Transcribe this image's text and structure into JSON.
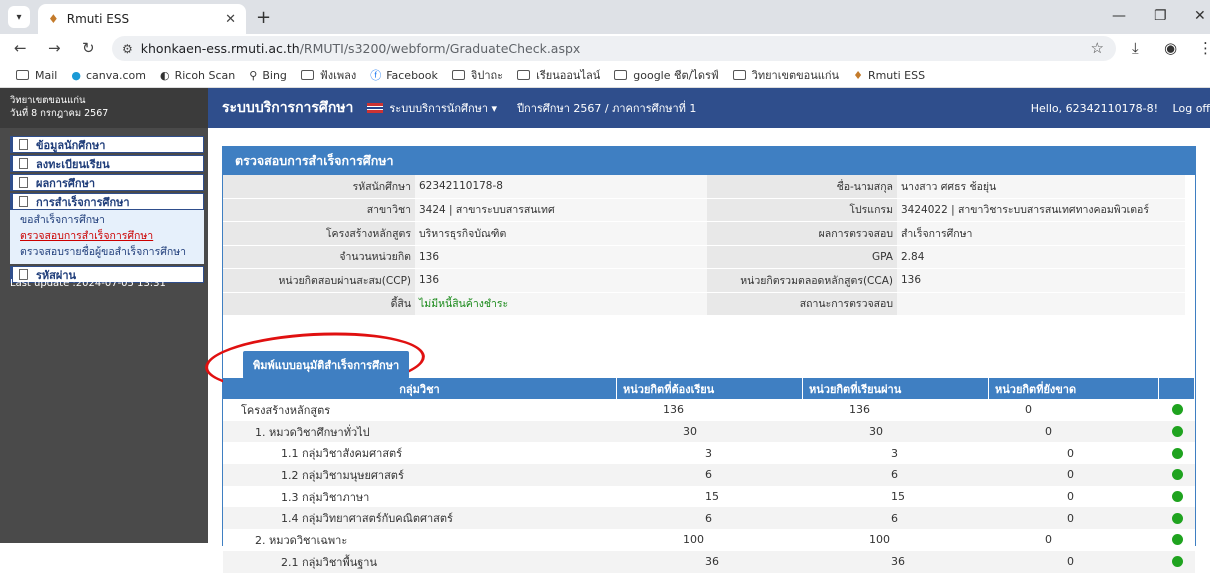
{
  "browser": {
    "tab_title": "Rmuti ESS",
    "url_host": "khonkaen-ess.rmuti.ac.th",
    "url_path": "/RMUTI/s3200/webform/GraduateCheck.aspx"
  },
  "bookmarks": [
    {
      "label": "Mail",
      "icon": "folder-icon"
    },
    {
      "label": "canva.com",
      "icon": "canva-icon"
    },
    {
      "label": "Ricoh Scan",
      "icon": "ricoh-icon"
    },
    {
      "label": "Bing",
      "icon": "search-icon"
    },
    {
      "label": "ฟังเพลง",
      "icon": "folder-icon"
    },
    {
      "label": "Facebook",
      "icon": "facebook-icon"
    },
    {
      "label": "จิปาถะ",
      "icon": "folder-icon"
    },
    {
      "label": "เรียนออนไลน์",
      "icon": "folder-icon"
    },
    {
      "label": "google ชีต/ไดรฟ์",
      "icon": "folder-icon"
    },
    {
      "label": "วิทยาเขตขอนแก่น",
      "icon": "folder-icon"
    },
    {
      "label": "Rmuti ESS",
      "icon": "rmuti-icon"
    }
  ],
  "header": {
    "campus": "วิทยาเขตขอนแก่น",
    "date": "วันที่ 8 กรกฎาคม 2567",
    "brand": "ระบบบริการการศึกษา",
    "system_menu": "ระบบบริการนักศึกษา ▾",
    "term": "ปีการศึกษา 2567 / ภาคการศึกษาที่ 1",
    "hello": "Hello, 62342110178-8!",
    "logout": "Log off"
  },
  "sidebar": {
    "items": [
      {
        "label": "ข้อมูลนักศึกษา"
      },
      {
        "label": "ลงทะเบียนเรียน"
      },
      {
        "label": "ผลการศึกษา"
      },
      {
        "label": "การสำเร็จการศึกษา"
      }
    ],
    "submenu": [
      {
        "label": "ขอสำเร็จการศึกษา"
      },
      {
        "label": "ตรวจสอบการสำเร็จการศึกษา"
      },
      {
        "label": "ตรวจสอบรายชื่อผู้ขอสำเร็จการศึกษา"
      }
    ],
    "password": "รหัสผ่าน",
    "last_update": "Last update :2024-07-05 13:31"
  },
  "panel": {
    "title": "ตรวจสอบการสำเร็จการศึกษา",
    "rows": [
      {
        "l1": "รหัสนักศึกษา",
        "v1": "62342110178-8",
        "l2": "ชื่อ-นามสกุล",
        "v2": "นางสาว ศศธร ช้อยุ่น"
      },
      {
        "l1": "สาขาวิชา",
        "v1": "3424 | สาขาระบบสารสนเทศ",
        "l2": "โปรแกรม",
        "v2": "3424022 | สาขาวิชาระบบสารสนเทศทางคอมพิวเตอร์"
      },
      {
        "l1": "โครงสร้างหลักสูตร",
        "v1": "บริหารธุรกิจบัณฑิต",
        "l2": "ผลการตรวจสอบ",
        "v2": "สำเร็จการศึกษา"
      },
      {
        "l1": "จำนวนหน่วยกิต",
        "v1": "136",
        "l2": "GPA",
        "v2": "2.84"
      },
      {
        "l1": "หน่วยกิตสอบผ่านสะสม(CCP)",
        "v1": "136",
        "l2": "หน่วยกิตรวมตลอดหลักสูตร(CCA)",
        "v2": "136"
      },
      {
        "l1": "ดี้สิน",
        "v1": "ไม่มีหนี้สินค้างชำระ",
        "l2": "สถานะการตรวจสอบ",
        "v2": ""
      }
    ],
    "print_button": "พิมพ์แบบอนุมัติสำเร็จการศึกษา"
  },
  "grid": {
    "headers": [
      "กลุ่มวิชา",
      "หน่วยกิตที่ต้องเรียน",
      "หน่วยกิตที่เรียนผ่าน",
      "หน่วยกิตที่ยังขาด"
    ],
    "rows": [
      {
        "name": "โครงสร้างหลักสูตร",
        "req": "136",
        "pass": "136",
        "miss": "0",
        "indent": 0
      },
      {
        "name": "1. หมวดวิชาศึกษาทั่วไป",
        "req": "30",
        "pass": "30",
        "miss": "0",
        "indent": 1
      },
      {
        "name": "1.1 กลุ่มวิชาสังคมศาสตร์",
        "req": "3",
        "pass": "3",
        "miss": "0",
        "indent": 2
      },
      {
        "name": "1.2 กลุ่มวิชามนุษยศาสตร์",
        "req": "6",
        "pass": "6",
        "miss": "0",
        "indent": 2
      },
      {
        "name": "1.3 กลุ่มวิชาภาษา",
        "req": "15",
        "pass": "15",
        "miss": "0",
        "indent": 2
      },
      {
        "name": "1.4 กลุ่มวิทยาศาสตร์กับคณิตศาสตร์",
        "req": "6",
        "pass": "6",
        "miss": "0",
        "indent": 2
      },
      {
        "name": "2. หมวดวิชาเฉพาะ",
        "req": "100",
        "pass": "100",
        "miss": "0",
        "indent": 1
      },
      {
        "name": "2.1 กลุ่มวิชาพื้นฐาน",
        "req": "36",
        "pass": "36",
        "miss": "0",
        "indent": 2
      }
    ]
  },
  "colors": {
    "brand": "#2f4e8c",
    "panel": "#3f7fc2",
    "status_ok": "#1fa31f",
    "annotation": "#e01010"
  }
}
